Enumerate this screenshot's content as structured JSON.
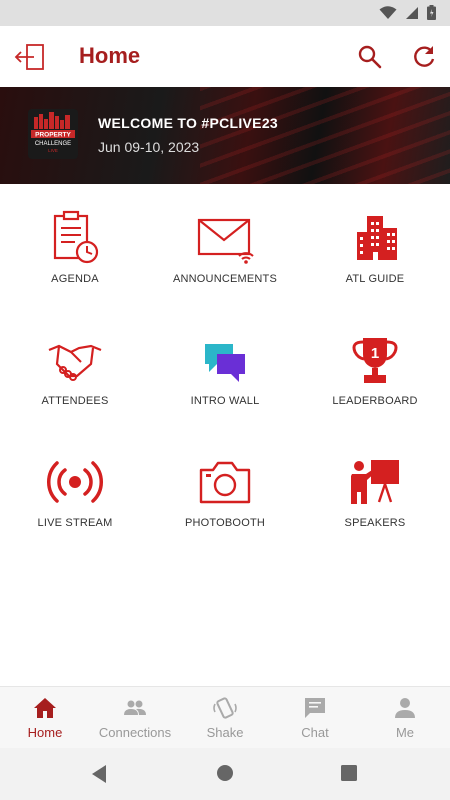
{
  "header": {
    "title": "Home"
  },
  "banner": {
    "title": "WELCOME TO #PCLIVE23",
    "date": "Jun 09-10, 2023",
    "logo_line1": "PROPERTY",
    "logo_line2": "CHALLENGE",
    "logo_line3": "LIVE"
  },
  "tiles": [
    {
      "label": "AGENDA",
      "icon": "agenda-icon"
    },
    {
      "label": "ANNOUNCEMENTS",
      "icon": "announcements-icon"
    },
    {
      "label": "ATL GUIDE",
      "icon": "city-guide-icon"
    },
    {
      "label": "ATTENDEES",
      "icon": "handshake-icon"
    },
    {
      "label": "INTRO WALL",
      "icon": "chat-bubbles-icon"
    },
    {
      "label": "LEADERBOARD",
      "icon": "trophy-icon"
    },
    {
      "label": "LIVE STREAM",
      "icon": "broadcast-icon"
    },
    {
      "label": "PHOTOBOOTH",
      "icon": "camera-icon"
    },
    {
      "label": "SPEAKERS",
      "icon": "presenter-icon"
    }
  ],
  "bottom_nav": [
    {
      "label": "Home",
      "icon": "home-icon",
      "active": true
    },
    {
      "label": "Connections",
      "icon": "people-icon",
      "active": false
    },
    {
      "label": "Shake",
      "icon": "shake-icon",
      "active": false
    },
    {
      "label": "Chat",
      "icon": "chat-icon",
      "active": false
    },
    {
      "label": "Me",
      "icon": "person-icon",
      "active": false
    }
  ],
  "colors": {
    "accent": "#a61e1e",
    "icon_red": "#d42020",
    "purple": "#6a2fd6",
    "teal": "#2bb6c9"
  }
}
